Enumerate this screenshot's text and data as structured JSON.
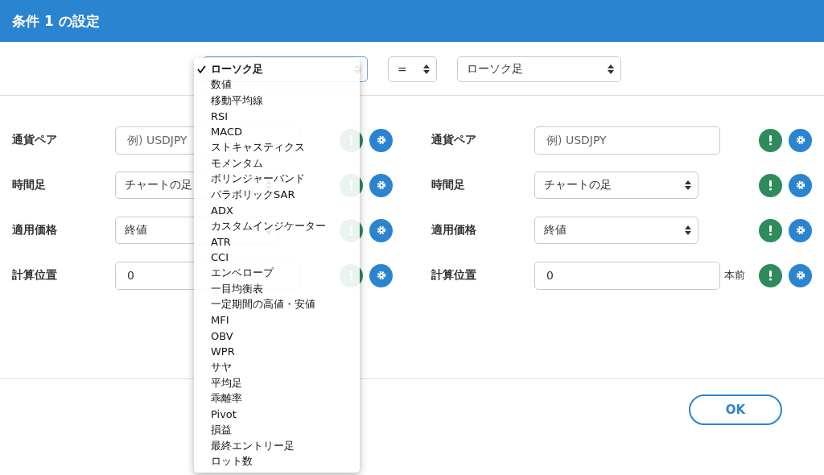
{
  "dialog": {
    "title": "条件 1 の設定"
  },
  "comparison": {
    "left_select": {
      "expanded": true,
      "options": [
        {
          "label": "ローソク足",
          "selected": true
        },
        {
          "label": "数値",
          "selected": false
        },
        {
          "label": "移動平均線",
          "selected": false
        },
        {
          "label": "RSI",
          "selected": false
        },
        {
          "label": "MACD",
          "selected": false
        },
        {
          "label": "ストキャスティクス",
          "selected": false
        },
        {
          "label": "モメンタム",
          "selected": false
        },
        {
          "label": "ボリンジャーバンド",
          "selected": false
        },
        {
          "label": "パラボリックSAR",
          "selected": false
        },
        {
          "label": "ADX",
          "selected": false
        },
        {
          "label": "カスタムインジケーター",
          "selected": false
        },
        {
          "label": "ATR",
          "selected": false
        },
        {
          "label": "CCI",
          "selected": false
        },
        {
          "label": "エンベロープ",
          "selected": false
        },
        {
          "label": "一目均衡表",
          "selected": false
        },
        {
          "label": "一定期間の高値・安値",
          "selected": false
        },
        {
          "label": "MFI",
          "selected": false
        },
        {
          "label": "OBV",
          "selected": false
        },
        {
          "label": "WPR",
          "selected": false
        },
        {
          "label": "サヤ",
          "selected": false
        },
        {
          "label": "平均足",
          "selected": false
        },
        {
          "label": "乖離率",
          "selected": false
        },
        {
          "label": "Pivot",
          "selected": false
        },
        {
          "label": "損益",
          "selected": false
        },
        {
          "label": "最終エントリー足",
          "selected": false
        },
        {
          "label": "ロット数",
          "selected": false
        }
      ]
    },
    "operator": {
      "value": "="
    },
    "right_select": {
      "value": "ローソク足"
    }
  },
  "columns": [
    {
      "rows": [
        {
          "kind": "text",
          "label": "通貨ペア",
          "placeholder": "例) USDJPY"
        },
        {
          "kind": "select",
          "label": "時間足",
          "value": "チャートの足"
        },
        {
          "kind": "select",
          "label": "適用価格",
          "value": "終値"
        },
        {
          "kind": "text",
          "label": "計算位置",
          "value": "0"
        }
      ]
    },
    {
      "rows": [
        {
          "kind": "text",
          "label": "通貨ペア",
          "placeholder": "例) USDJPY"
        },
        {
          "kind": "select",
          "label": "時間足",
          "value": "チャートの足"
        },
        {
          "kind": "select",
          "label": "適用価格",
          "value": "終値"
        },
        {
          "kind": "text",
          "label": "計算位置",
          "value": "0",
          "suffix": "本前"
        }
      ]
    }
  ],
  "buttons": [
    {
      "label": "OK"
    }
  ]
}
